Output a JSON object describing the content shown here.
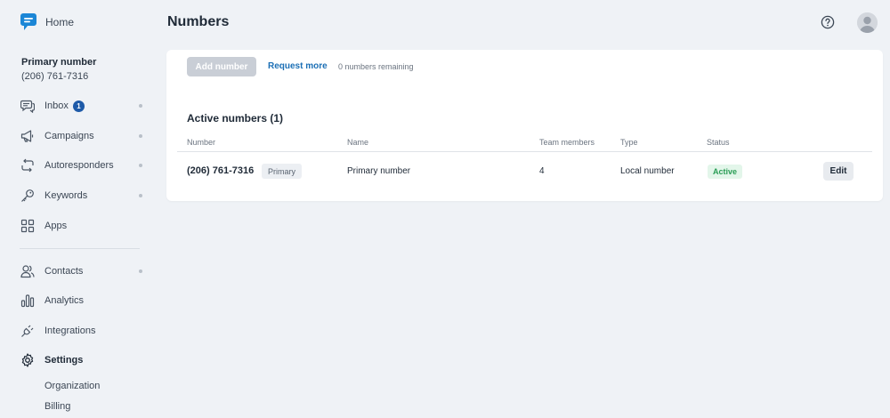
{
  "sidebar": {
    "home_label": "Home",
    "primary_number_title": "Primary number",
    "primary_number_phone": "(206) 761-7316",
    "nav": [
      {
        "label": "Inbox",
        "icon": "chat-bubbles-icon",
        "badge": "1",
        "dot": true
      },
      {
        "label": "Campaigns",
        "icon": "megaphone-icon",
        "dot": true
      },
      {
        "label": "Autoresponders",
        "icon": "auto-reply-icon",
        "dot": true
      },
      {
        "label": "Keywords",
        "icon": "key-icon",
        "dot": true
      },
      {
        "label": "Apps",
        "icon": "apps-grid-icon",
        "dot": false
      },
      {
        "label": "Contacts",
        "icon": "contacts-icon",
        "dot": true
      },
      {
        "label": "Analytics",
        "icon": "bar-chart-icon",
        "dot": false
      },
      {
        "label": "Integrations",
        "icon": "plug-icon",
        "dot": false
      },
      {
        "label": "Settings",
        "icon": "gear-icon",
        "dot": false
      }
    ],
    "settings_sub": [
      "Organization",
      "Billing"
    ]
  },
  "header": {
    "title": "Numbers"
  },
  "card": {
    "add_button": "Add number",
    "request_more": "Request more",
    "remaining": "0 numbers remaining",
    "section_title": "Active numbers (1)",
    "columns": [
      "Number",
      "Name",
      "Team members",
      "Type",
      "Status"
    ],
    "rows": [
      {
        "number": "(206) 761-7316",
        "tag": "Primary",
        "name": "Primary number",
        "team_members": "4",
        "type": "Local number",
        "status": "Active",
        "action": "Edit"
      }
    ]
  },
  "colors": {
    "accent_link": "#1b6fb5",
    "badge": "#1e5aa8",
    "status_active": "#2a9d55",
    "background": "#eff2f6"
  }
}
